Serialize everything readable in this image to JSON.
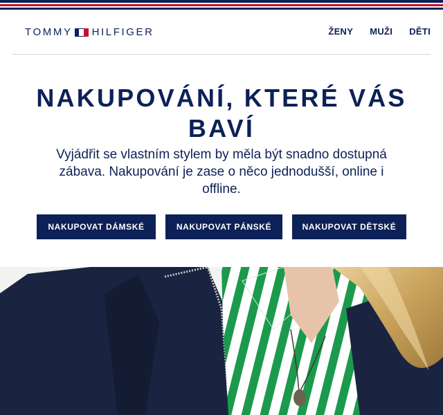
{
  "brand": {
    "name_left": "TOMMY",
    "name_right": "HILFIGER",
    "colors": {
      "navy": "#0c2157",
      "red": "#c8102e",
      "white": "#ffffff"
    }
  },
  "nav": {
    "items": [
      {
        "label": "ŽENY"
      },
      {
        "label": "MUŽI"
      },
      {
        "label": "DĚTI"
      }
    ]
  },
  "hero": {
    "headline": "NAKUPOVÁNÍ, KTERÉ VÁS BAVÍ",
    "subtext": "Vyjádřit se vlastním stylem by měla být snadno dostupná zábava. Nakupování je zase o něco jednodušší, online i offline.",
    "buttons": [
      {
        "label": "NAKUPOVAT DÁMSKÉ"
      },
      {
        "label": "NAKUPOVAT PÁNSKÉ"
      },
      {
        "label": "NAKUPOVAT DĚTSKÉ"
      }
    ]
  }
}
